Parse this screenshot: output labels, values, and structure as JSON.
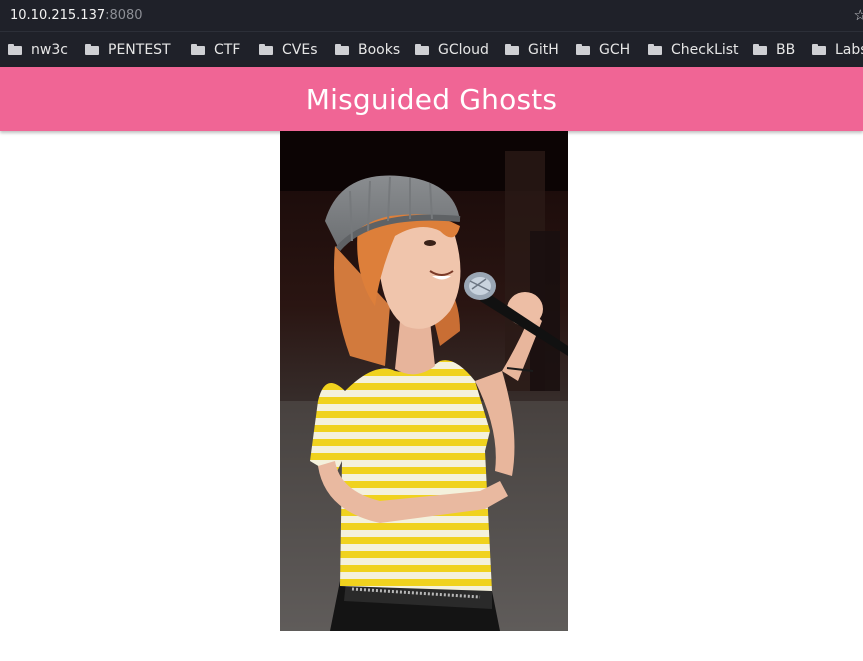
{
  "browser": {
    "url_host": "10.10.215.137",
    "url_port": ":8080",
    "bookmark_icon": "star-icon",
    "bookmarks": [
      {
        "label": "nw3c"
      },
      {
        "label": "PENTEST"
      },
      {
        "label": "CTF"
      },
      {
        "label": "CVEs"
      },
      {
        "label": "Books"
      },
      {
        "label": "GCloud"
      },
      {
        "label": "GitH"
      },
      {
        "label": "GCH"
      },
      {
        "label": "CheckList"
      },
      {
        "label": "BB"
      },
      {
        "label": "Labs"
      }
    ]
  },
  "page": {
    "title": "Misguided Ghosts",
    "header_color": "#f06595",
    "image_alt": "woman singing into a microphone"
  }
}
